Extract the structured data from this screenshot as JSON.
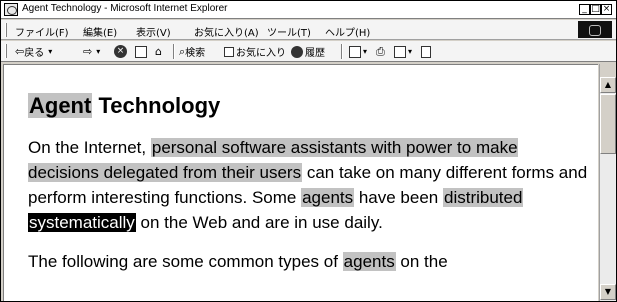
{
  "window": {
    "title": "Agent Technology - Microsoft Internet Explorer",
    "minimize": "_",
    "maximize": "□",
    "close": "×"
  },
  "menu": [
    "ファイル(F)",
    "編集(E)",
    "表示(V)",
    "お気に入り(A)",
    "ツール(T)",
    "ヘルプ(H)"
  ],
  "toolbar": {
    "back_label": "戻る",
    "search_label": "検索",
    "favorites_label": "お気に入り",
    "history_label": "履歴"
  },
  "page": {
    "heading": {
      "highlighted": "Agent",
      "rest": " Technology"
    },
    "paragraph1": {
      "t1": "On the Internet, ",
      "h1": "personal software assistants with power to make decisions delegated from their users",
      "t2": " can take on many different forms and perform interesting functions. Some ",
      "h2": "agents",
      "t3": " have been ",
      "h3": "distributed",
      "t4": " ",
      "selected": "systematically",
      "t5": " on the Web and are in use daily."
    },
    "paragraph2": {
      "t1": "The following are some common types of ",
      "h1": "agents",
      "t2": " on the"
    }
  },
  "icons": {
    "app": "ie-page-icon",
    "back": "back-arrow-icon",
    "forward": "forward-arrow-icon",
    "stop": "stop-icon",
    "refresh": "refresh-icon",
    "home": "home-icon",
    "search": "search-icon",
    "favorites": "favorites-icon",
    "history": "history-icon",
    "mail": "mail-icon",
    "print": "print-icon",
    "edit": "edit-icon",
    "discuss": "discuss-icon"
  },
  "colors": {
    "highlight": "#c2c2c2",
    "selection": "#000000",
    "selection_text": "#ffffff"
  }
}
